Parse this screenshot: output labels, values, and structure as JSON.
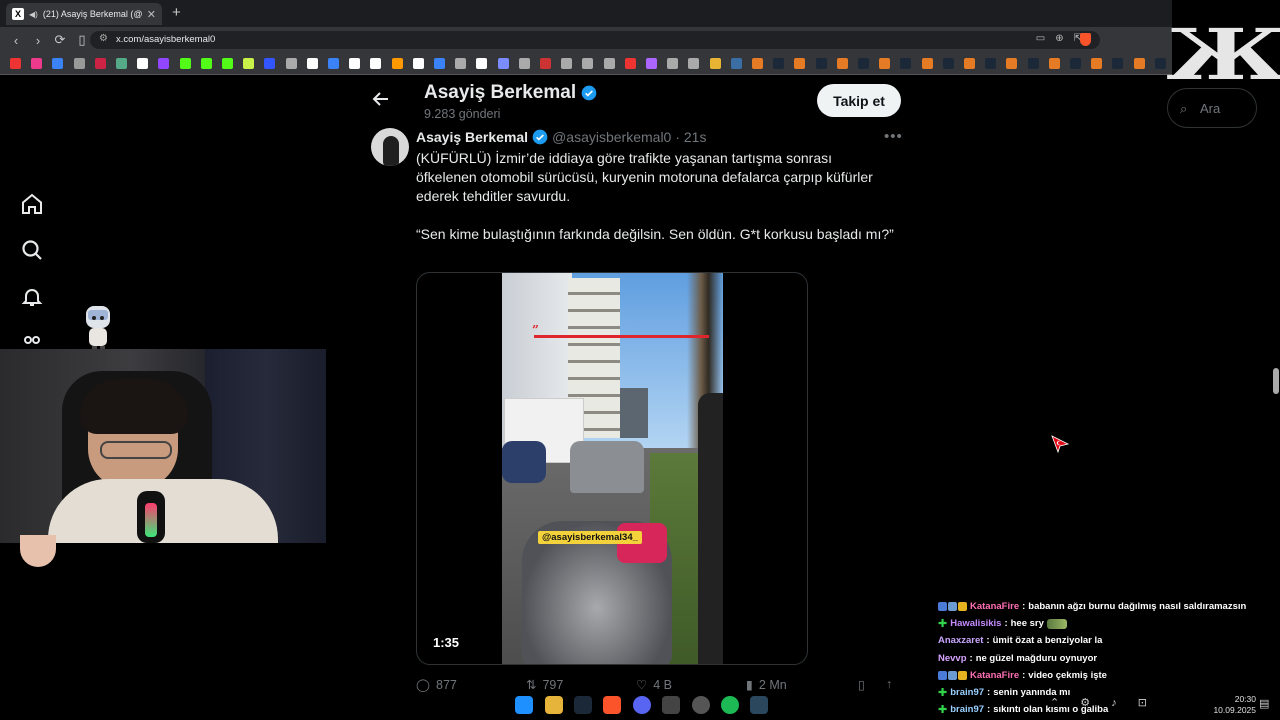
{
  "browser": {
    "tab_title": "(21) Asayiş Berkemal (@asayis...",
    "url": "x.com/asayisberkemal0"
  },
  "profile_header": {
    "name": "Asayiş Berkemal",
    "post_count": "9.283 gönderi",
    "follow_label": "Takip et",
    "search_placeholder": "Ara"
  },
  "tweet": {
    "author_name": "Asayiş Berkemal",
    "handle": "@asayisberkemal0",
    "time": "· 21s",
    "paragraphs": [
      "(KÜFÜRLÜ) İzmir’de iddiaya göre trafikte yaşanan tartışma sonrası öfkelenen otomobil sürücüsü, kuryenin motoruna defalarca çarpıp küfürler ederek tehditler savurdu.",
      "“Sen kime bulaştığının farkında değilsin. Sen öldün. G*t korkusu başladı mı?”"
    ],
    "video_duration": "1:35",
    "video_watermark": "@asayisberkemal34_",
    "video_quote_mark": "”",
    "actions": {
      "replies": "877",
      "reposts": "797",
      "likes": "4 B",
      "views": "2 Mn"
    }
  },
  "chat": [
    {
      "user": "KatanaFire",
      "color": "#ff6fb3",
      "text": "babanın ağzı burnu dağılmış nasıl saldıramazsın",
      "badges": [
        "#4b7bd8",
        "#6c9bd2",
        "#e7b21f"
      ],
      "plus": false,
      "emote": false
    },
    {
      "user": "Hawalisikis",
      "color": "#c58bff",
      "text": "hee sry",
      "badges": [],
      "plus": true,
      "emote": true
    },
    {
      "user": "Anaxzaret",
      "color": "#c9a6ff",
      "text": "ümit özat a benziyolar la",
      "badges": [],
      "plus": false,
      "emote": false
    },
    {
      "user": "Nevvp",
      "color": "#d8a3ff",
      "text": "ne güzel mağduru oynuyor",
      "badges": [],
      "plus": false,
      "emote": false
    },
    {
      "user": "KatanaFire",
      "color": "#ff6fb3",
      "text": "video çekmiş işte",
      "badges": [
        "#4b7bd8",
        "#6c9bd2",
        "#e7b21f"
      ],
      "plus": false,
      "emote": false
    },
    {
      "user": "brain97",
      "color": "#9ad0ff",
      "text": "senin yanında mı",
      "badges": [],
      "plus": true,
      "emote": false
    },
    {
      "user": "brain97",
      "color": "#9ad0ff",
      "text": "sıkıntı olan kısmı o galiba",
      "badges": [],
      "plus": true,
      "emote": false
    }
  ],
  "taskbar": {
    "time": "20:30",
    "date": "10.09.2025"
  },
  "colors": {
    "verified_blue": "#1d9bf0",
    "bg": "#000000",
    "muted": "#71767b"
  }
}
